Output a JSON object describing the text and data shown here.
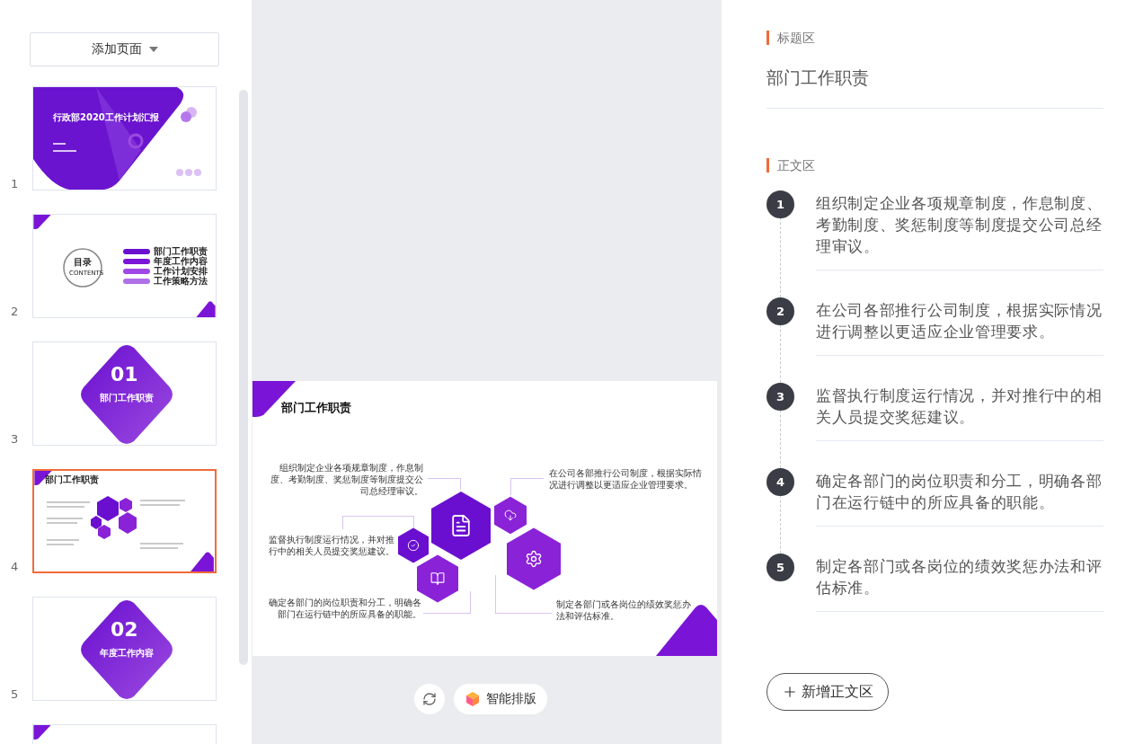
{
  "add_page_button": {
    "label": "添加页面"
  },
  "slides": [
    {
      "number": "1",
      "kind": "cover",
      "selected": false,
      "title": "行政部2020工作计划汇报"
    },
    {
      "number": "2",
      "kind": "contents",
      "selected": false,
      "title": "目录",
      "subtitle": "CONTENTS",
      "items": [
        "部门工作职责",
        "年度工作内容",
        "工作计划安排",
        "工作策略方法"
      ]
    },
    {
      "number": "3",
      "kind": "section",
      "selected": false,
      "index": "01",
      "title": "部门工作职责"
    },
    {
      "number": "4",
      "kind": "points",
      "selected": true,
      "title": "部门工作职责"
    },
    {
      "number": "5",
      "kind": "section",
      "selected": false,
      "index": "02",
      "title": "年度工作内容"
    },
    {
      "kind": "corner",
      "selected": false
    }
  ],
  "preview": {
    "title": "部门工作职责",
    "points": [
      "组织制定企业各项规章制度，作息制度、考勤制度、奖惩制度等制度提交公司总经理审议。",
      "在公司各部推行公司制度，根据实际情况进行调整以更适应企业管理要求。",
      "监督执行制度运行情况，并对推行中的相关人员提交奖惩建议。",
      "确定各部门的岗位职责和分工，明确各部门在运行链中的所应具备的职能。",
      "制定各部门或各岗位的绩效奖惩办法和评估标准。"
    ]
  },
  "toolbar": {
    "smart_layout_button": "智能排版"
  },
  "editor": {
    "title_section": {
      "label": "标题区",
      "value": "部门工作职责"
    },
    "body_section": {
      "label": "正文区",
      "items": [
        {
          "number": "1",
          "text": "组织制定企业各项规章制度，作息制度、考勤制度、奖惩制度等制度提交公司总经理审议。"
        },
        {
          "number": "2",
          "text": "在公司各部推行公司制度，根据实际情况进行调整以更适应企业管理要求。"
        },
        {
          "number": "3",
          "text": "监督执行制度运行情况，并对推行中的相关人员提交奖惩建议。"
        },
        {
          "number": "4",
          "text": "确定各部门的岗位职责和分工，明确各部门在运行链中的所应具备的职能。"
        },
        {
          "number": "5",
          "text": "制定各部门或各岗位的绩效奖惩办法和评估标准。"
        }
      ]
    },
    "add_button": "新增正文区"
  }
}
